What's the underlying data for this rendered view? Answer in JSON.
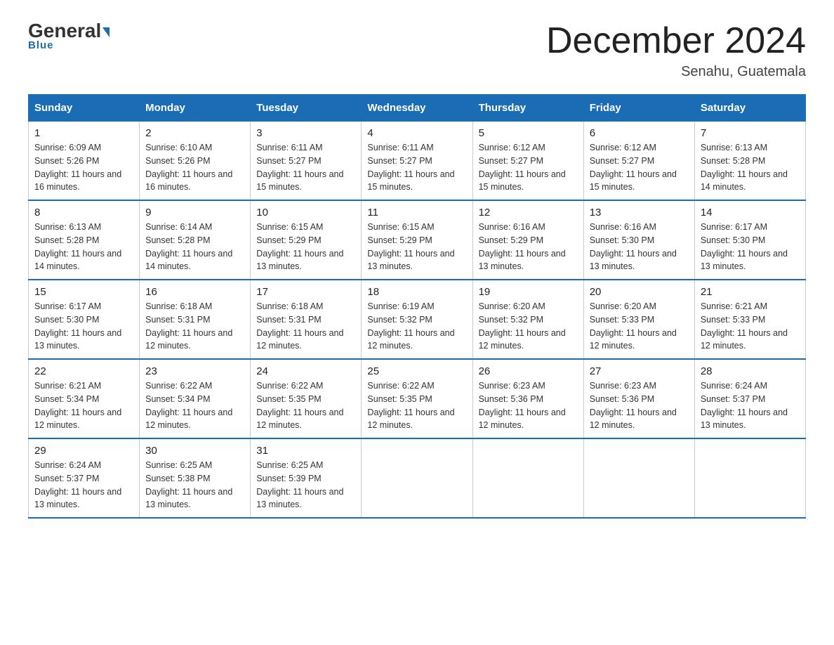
{
  "header": {
    "logo_general": "General",
    "logo_blue": "Blue",
    "month_title": "December 2024",
    "location": "Senahu, Guatemala"
  },
  "days_of_week": [
    "Sunday",
    "Monday",
    "Tuesday",
    "Wednesday",
    "Thursday",
    "Friday",
    "Saturday"
  ],
  "weeks": [
    [
      {
        "day": "1",
        "sunrise": "6:09 AM",
        "sunset": "5:26 PM",
        "daylight": "11 hours and 16 minutes."
      },
      {
        "day": "2",
        "sunrise": "6:10 AM",
        "sunset": "5:26 PM",
        "daylight": "11 hours and 16 minutes."
      },
      {
        "day": "3",
        "sunrise": "6:11 AM",
        "sunset": "5:27 PM",
        "daylight": "11 hours and 15 minutes."
      },
      {
        "day": "4",
        "sunrise": "6:11 AM",
        "sunset": "5:27 PM",
        "daylight": "11 hours and 15 minutes."
      },
      {
        "day": "5",
        "sunrise": "6:12 AM",
        "sunset": "5:27 PM",
        "daylight": "11 hours and 15 minutes."
      },
      {
        "day": "6",
        "sunrise": "6:12 AM",
        "sunset": "5:27 PM",
        "daylight": "11 hours and 15 minutes."
      },
      {
        "day": "7",
        "sunrise": "6:13 AM",
        "sunset": "5:28 PM",
        "daylight": "11 hours and 14 minutes."
      }
    ],
    [
      {
        "day": "8",
        "sunrise": "6:13 AM",
        "sunset": "5:28 PM",
        "daylight": "11 hours and 14 minutes."
      },
      {
        "day": "9",
        "sunrise": "6:14 AM",
        "sunset": "5:28 PM",
        "daylight": "11 hours and 14 minutes."
      },
      {
        "day": "10",
        "sunrise": "6:15 AM",
        "sunset": "5:29 PM",
        "daylight": "11 hours and 13 minutes."
      },
      {
        "day": "11",
        "sunrise": "6:15 AM",
        "sunset": "5:29 PM",
        "daylight": "11 hours and 13 minutes."
      },
      {
        "day": "12",
        "sunrise": "6:16 AM",
        "sunset": "5:29 PM",
        "daylight": "11 hours and 13 minutes."
      },
      {
        "day": "13",
        "sunrise": "6:16 AM",
        "sunset": "5:30 PM",
        "daylight": "11 hours and 13 minutes."
      },
      {
        "day": "14",
        "sunrise": "6:17 AM",
        "sunset": "5:30 PM",
        "daylight": "11 hours and 13 minutes."
      }
    ],
    [
      {
        "day": "15",
        "sunrise": "6:17 AM",
        "sunset": "5:30 PM",
        "daylight": "11 hours and 13 minutes."
      },
      {
        "day": "16",
        "sunrise": "6:18 AM",
        "sunset": "5:31 PM",
        "daylight": "11 hours and 12 minutes."
      },
      {
        "day": "17",
        "sunrise": "6:18 AM",
        "sunset": "5:31 PM",
        "daylight": "11 hours and 12 minutes."
      },
      {
        "day": "18",
        "sunrise": "6:19 AM",
        "sunset": "5:32 PM",
        "daylight": "11 hours and 12 minutes."
      },
      {
        "day": "19",
        "sunrise": "6:20 AM",
        "sunset": "5:32 PM",
        "daylight": "11 hours and 12 minutes."
      },
      {
        "day": "20",
        "sunrise": "6:20 AM",
        "sunset": "5:33 PM",
        "daylight": "11 hours and 12 minutes."
      },
      {
        "day": "21",
        "sunrise": "6:21 AM",
        "sunset": "5:33 PM",
        "daylight": "11 hours and 12 minutes."
      }
    ],
    [
      {
        "day": "22",
        "sunrise": "6:21 AM",
        "sunset": "5:34 PM",
        "daylight": "11 hours and 12 minutes."
      },
      {
        "day": "23",
        "sunrise": "6:22 AM",
        "sunset": "5:34 PM",
        "daylight": "11 hours and 12 minutes."
      },
      {
        "day": "24",
        "sunrise": "6:22 AM",
        "sunset": "5:35 PM",
        "daylight": "11 hours and 12 minutes."
      },
      {
        "day": "25",
        "sunrise": "6:22 AM",
        "sunset": "5:35 PM",
        "daylight": "11 hours and 12 minutes."
      },
      {
        "day": "26",
        "sunrise": "6:23 AM",
        "sunset": "5:36 PM",
        "daylight": "11 hours and 12 minutes."
      },
      {
        "day": "27",
        "sunrise": "6:23 AM",
        "sunset": "5:36 PM",
        "daylight": "11 hours and 12 minutes."
      },
      {
        "day": "28",
        "sunrise": "6:24 AM",
        "sunset": "5:37 PM",
        "daylight": "11 hours and 13 minutes."
      }
    ],
    [
      {
        "day": "29",
        "sunrise": "6:24 AM",
        "sunset": "5:37 PM",
        "daylight": "11 hours and 13 minutes."
      },
      {
        "day": "30",
        "sunrise": "6:25 AM",
        "sunset": "5:38 PM",
        "daylight": "11 hours and 13 minutes."
      },
      {
        "day": "31",
        "sunrise": "6:25 AM",
        "sunset": "5:39 PM",
        "daylight": "11 hours and 13 minutes."
      },
      null,
      null,
      null,
      null
    ]
  ]
}
